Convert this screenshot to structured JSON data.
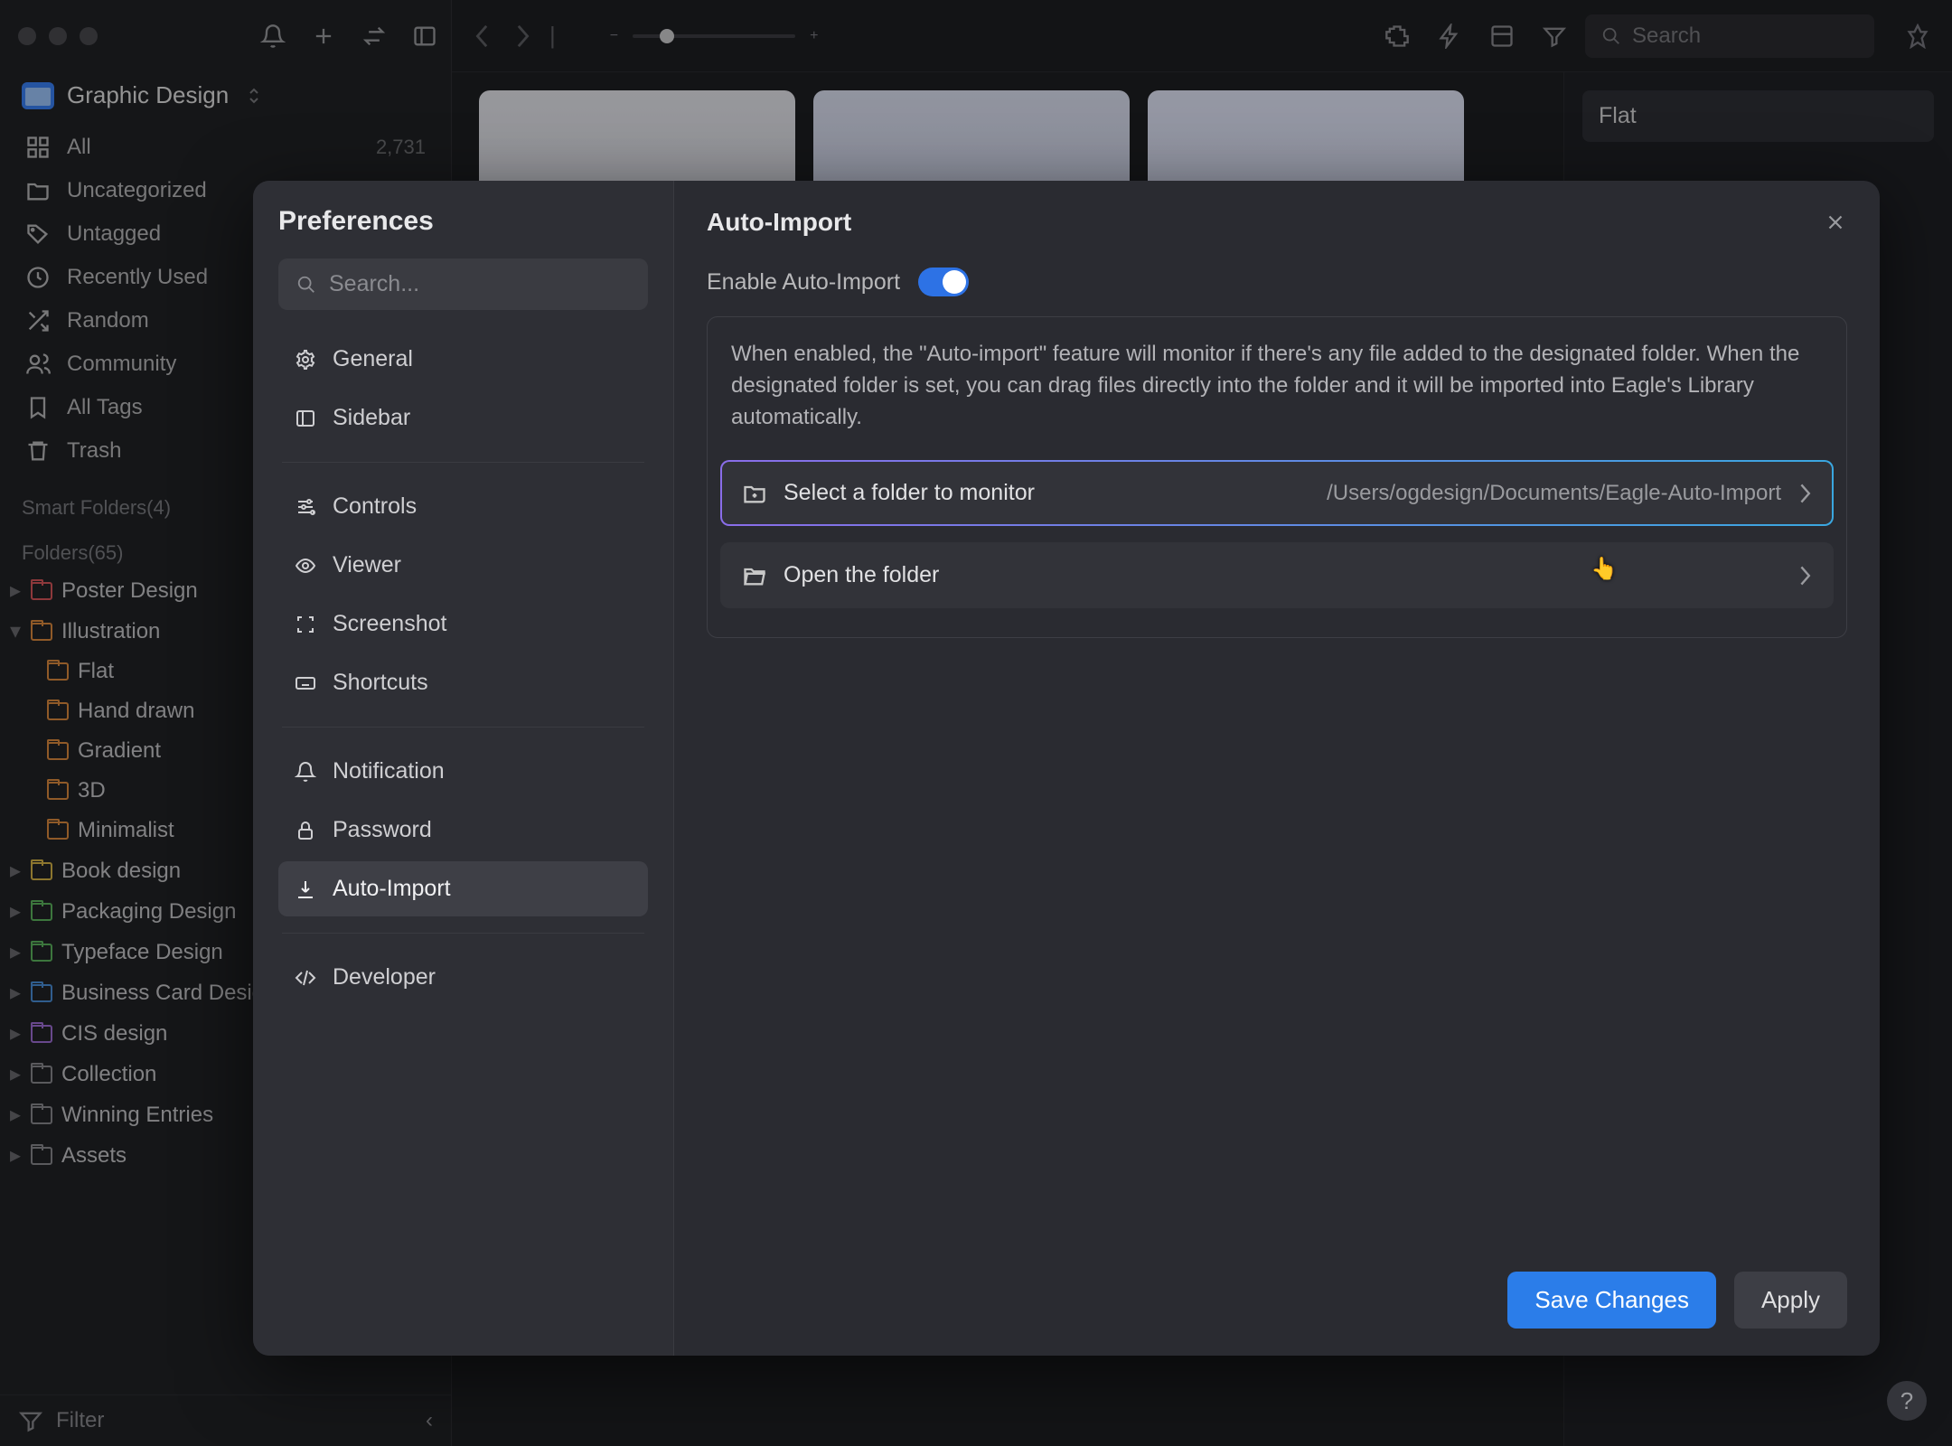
{
  "library": {
    "title": "Graphic Design"
  },
  "topbar": {
    "search_placeholder": "Search"
  },
  "sidebar": {
    "items": [
      {
        "icon": "grid",
        "label": "All",
        "count": "2,731"
      },
      {
        "icon": "folder",
        "label": "Uncategorized"
      },
      {
        "icon": "tag",
        "label": "Untagged"
      },
      {
        "icon": "clock",
        "label": "Recently Used"
      },
      {
        "icon": "shuffle",
        "label": "Random"
      },
      {
        "icon": "people",
        "label": "Community"
      },
      {
        "icon": "bookmark",
        "label": "All Tags"
      },
      {
        "icon": "trash",
        "label": "Trash"
      }
    ],
    "smart_label": "Smart Folders(4)",
    "folders_label": "Folders(65)",
    "folders": [
      {
        "color": "red",
        "label": "Poster Design",
        "expanded": false
      },
      {
        "color": "orange",
        "label": "Illustration",
        "expanded": true,
        "children": [
          {
            "label": "Flat"
          },
          {
            "label": "Hand drawn"
          },
          {
            "label": "Gradient"
          },
          {
            "label": "3D"
          },
          {
            "label": "Minimalist"
          }
        ]
      },
      {
        "color": "yellow",
        "label": "Book design"
      },
      {
        "color": "green",
        "label": "Packaging Design"
      },
      {
        "color": "green",
        "label": "Typeface Design"
      },
      {
        "color": "blue",
        "label": "Business Card Design"
      },
      {
        "color": "purple",
        "label": "CIS design"
      },
      {
        "color": "gray",
        "label": "Collection"
      },
      {
        "color": "gray",
        "label": "Winning Entries"
      },
      {
        "color": "gray",
        "label": "Assets"
      }
    ],
    "filter_placeholder": "Filter"
  },
  "rightpanel": {
    "tag": "Flat"
  },
  "modal": {
    "sidebar_title": "Preferences",
    "search_placeholder": "Search...",
    "groups": [
      [
        "General",
        "Sidebar"
      ],
      [
        "Controls",
        "Viewer",
        "Screenshot",
        "Shortcuts"
      ],
      [
        "Notification",
        "Password",
        "Auto-Import"
      ],
      [
        "Developer"
      ]
    ],
    "selected": "Auto-Import",
    "title": "Auto-Import",
    "enable_label": "Enable Auto-Import",
    "enable_on": true,
    "description": "When enabled, the \"Auto-import\" feature will monitor if there's any file added to the designated folder. When the designated folder is set, you can drag files directly into the folder and it will be imported into Eagle's Library automatically.",
    "select_label": "Select a folder to monitor",
    "select_path": "/Users/ogdesign/Documents/Eagle-Auto-Import",
    "open_label": "Open the folder",
    "save_label": "Save Changes",
    "apply_label": "Apply"
  }
}
